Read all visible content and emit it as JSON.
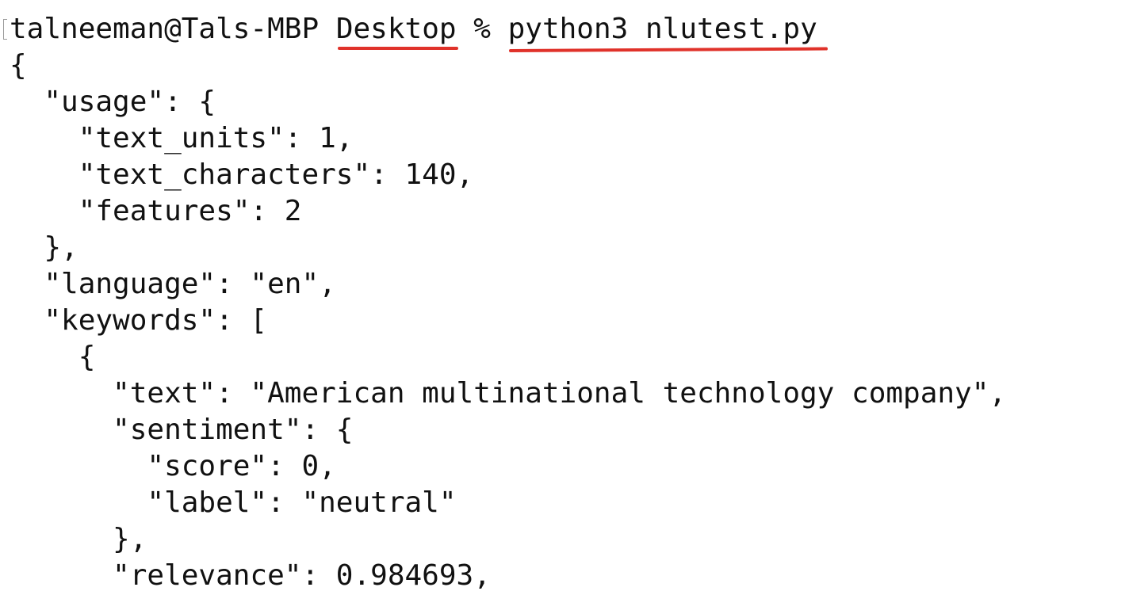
{
  "prompt": {
    "user_host": "talneeman@Tals-MBP",
    "directory": "Desktop",
    "symbol": "%",
    "command": "python3 nlutest.py"
  },
  "annotations": {
    "underline_color": "#e0322a"
  },
  "output_lines": [
    "{",
    "  \"usage\": {",
    "    \"text_units\": 1,",
    "    \"text_characters\": 140,",
    "    \"features\": 2",
    "  },",
    "  \"language\": \"en\",",
    "  \"keywords\": [",
    "    {",
    "      \"text\": \"American multinational technology company\",",
    "      \"sentiment\": {",
    "        \"score\": 0,",
    "        \"label\": \"neutral\"",
    "      },",
    "      \"relevance\": 0.984693,"
  ]
}
